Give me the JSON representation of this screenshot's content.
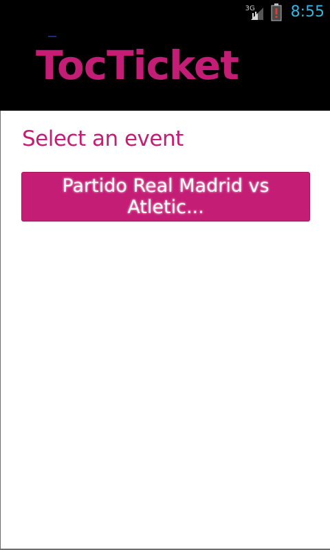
{
  "status_bar": {
    "network_type": "3G",
    "time": "8:55",
    "icons": [
      "signal-icon",
      "battery-alert-icon"
    ],
    "clock_color": "#33b5e5"
  },
  "header": {
    "app_title": "TocTicket",
    "brand_color": "#c41d75",
    "background": "#000000"
  },
  "main": {
    "title": "Select an event",
    "events": [
      {
        "label": "Partido Real Madrid vs Atletic..."
      }
    ]
  }
}
